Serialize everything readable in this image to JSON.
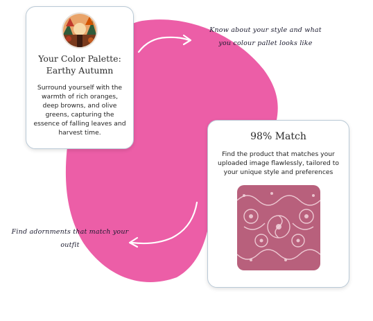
{
  "palette_card": {
    "title_line1": "Your Color Palette:",
    "title_line2": "Earthy Autumn",
    "description": "Surround yourself with the warmth of rich oranges, deep browns, and olive greens, capturing the essence of falling leaves and harvest time."
  },
  "match_card": {
    "title": "98% Match",
    "description": "Find the product that matches your uploaded image flawlessly, tailored to your unique style and preferences"
  },
  "annotations": {
    "top_line1": "Know about your style and what",
    "top_line2": "you colour pallet looks like",
    "bottom_line1": "Find adornments that match your",
    "bottom_line2": "outfit"
  },
  "colors": {
    "blob": "#ec5ea7",
    "card_border": "#b9c9d6",
    "lace_background": "#b8607c",
    "lace_pattern": "#f3d4dc"
  },
  "icons": {
    "palette_avatar": "autumn-landscape-avatar",
    "product_image": "pink-lace-trim-image",
    "arrow_top": "curved-arrow-right-icon",
    "arrow_bottom": "curved-arrow-left-icon"
  }
}
